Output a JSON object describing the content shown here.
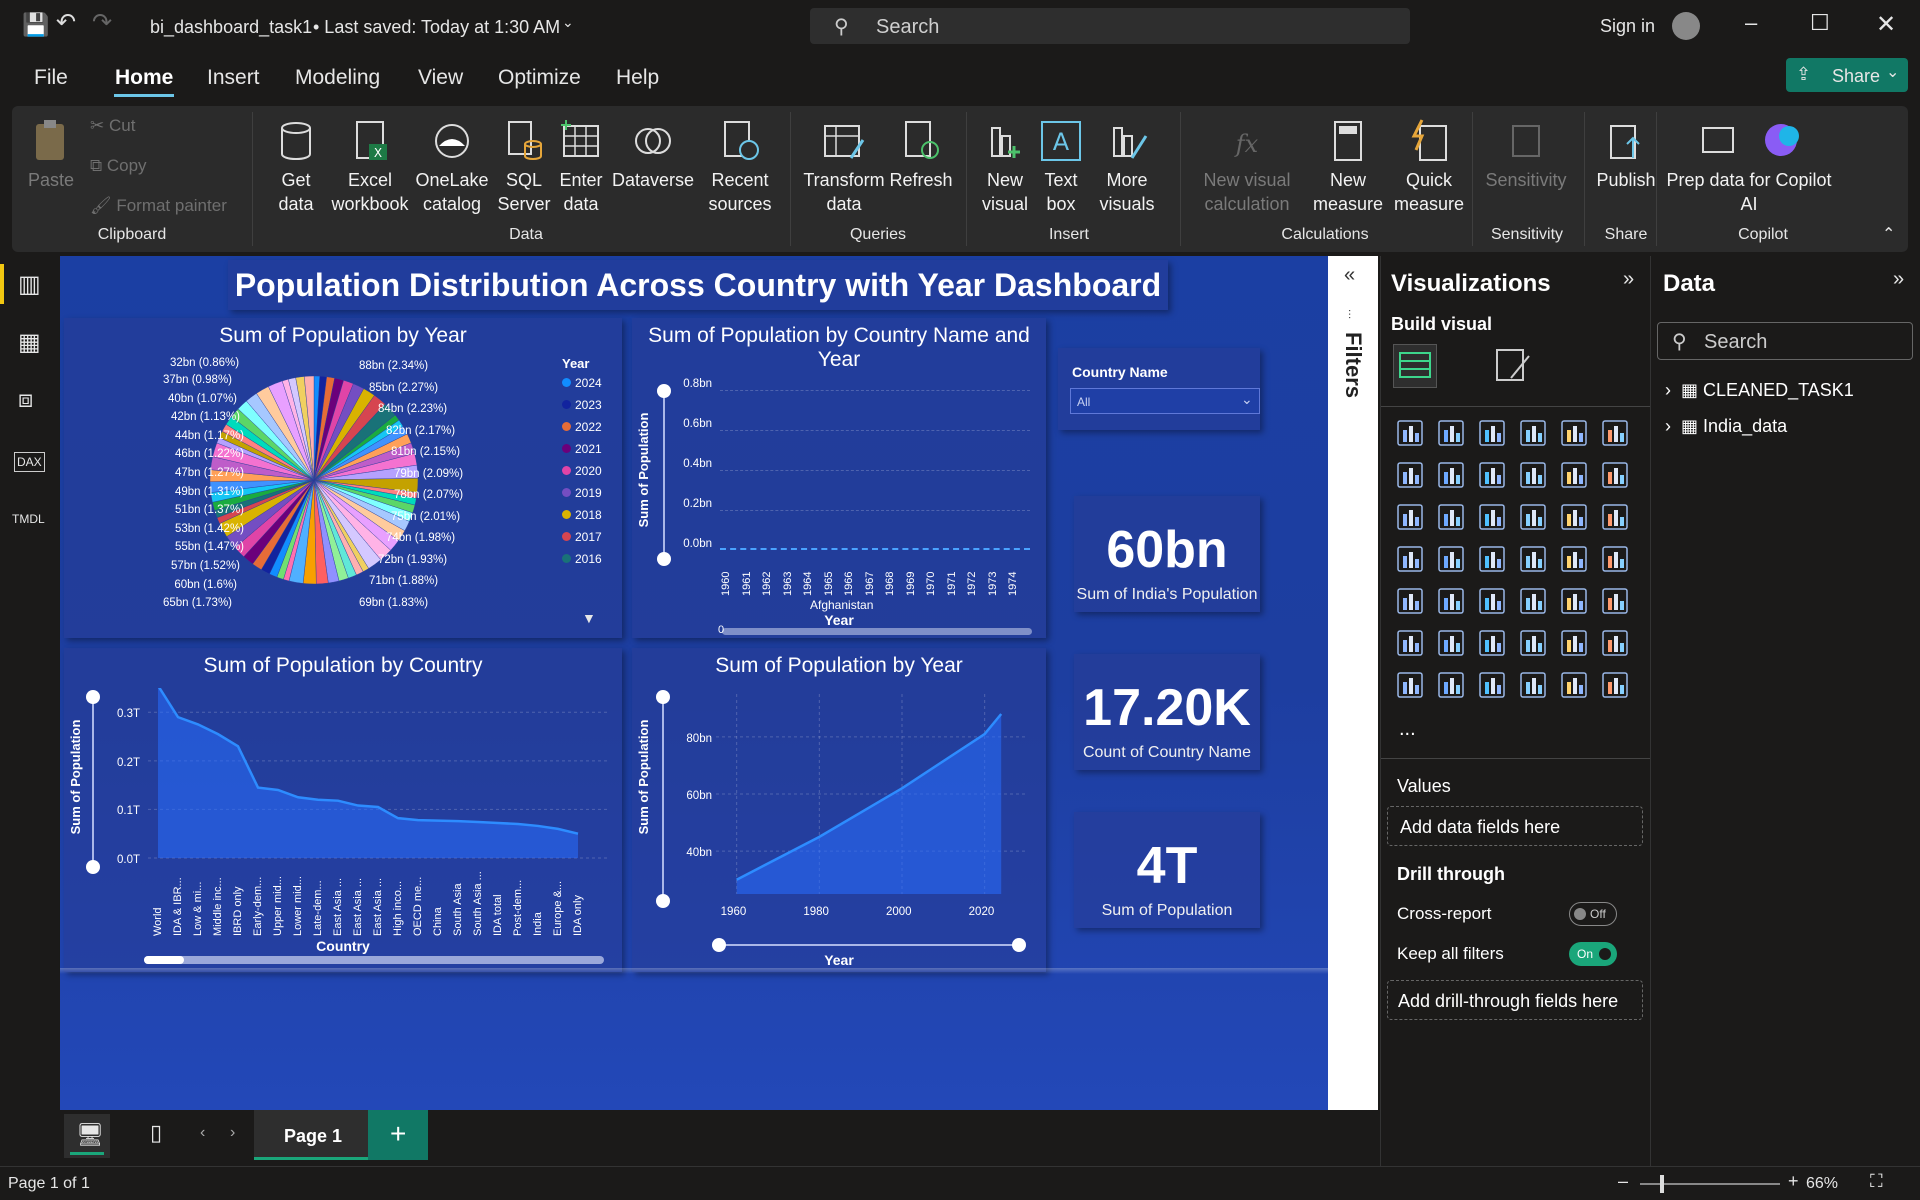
{
  "titlebar": {
    "filename": "bi_dashboard_task1",
    "saved": "• Last saved: Today at 1:30 AM",
    "search_placeholder": "Search",
    "signin": "Sign in",
    "share": "Share"
  },
  "menu": [
    "File",
    "Home",
    "Insert",
    "Modeling",
    "View",
    "Optimize",
    "Help"
  ],
  "ribbon": {
    "paste": "Paste",
    "cut": "Cut",
    "copy": "Copy",
    "format_painter": "Format painter",
    "get_data": "Get data",
    "excel": "Excel workbook",
    "onelake": "OneLake catalog",
    "sql": "SQL Server",
    "enter": "Enter data",
    "dataverse": "Dataverse",
    "recent": "Recent sources",
    "transform": "Transform data",
    "refresh": "Refresh",
    "new_visual": "New visual",
    "text_box": "Text box",
    "more_visuals": "More visuals",
    "new_calc": "New visual calculation",
    "new_measure": "New measure",
    "quick_measure": "Quick measure",
    "sensitivity": "Sensitivity",
    "publish": "Publish",
    "prep": "Prep data for Copilot AI",
    "groups": {
      "clipboard": "Clipboard",
      "data": "Data",
      "queries": "Queries",
      "insert": "Insert",
      "calculations": "Calculations",
      "sensitivity": "Sensitivity",
      "share": "Share",
      "copilot": "Copilot"
    }
  },
  "dashboard": {
    "title": "Population Distribution Across Country with Year Dashboard",
    "pie_title": "Sum of Population by Year",
    "pie_legend_title": "Year",
    "pie_legend": [
      {
        "label": "2024",
        "color": "#118dff"
      },
      {
        "label": "2023",
        "color": "#12239e"
      },
      {
        "label": "2022",
        "color": "#e66c37"
      },
      {
        "label": "2021",
        "color": "#6b007b"
      },
      {
        "label": "2020",
        "color": "#e044a7"
      },
      {
        "label": "2019",
        "color": "#744ec2"
      },
      {
        "label": "2018",
        "color": "#d9b300"
      },
      {
        "label": "2017",
        "color": "#d64550"
      },
      {
        "label": "2016",
        "color": "#197278"
      }
    ],
    "pie_labels_left": [
      "32bn (0.86%)",
      "37bn (0.98%)",
      "40bn (1.07%)",
      "42bn (1.13%)",
      "44bn (1.17%)",
      "46bn (1.22%)",
      "47bn (1.27%)",
      "49bn (1.31%)",
      "51bn (1.37%)",
      "53bn (1.42%)",
      "55bn (1.47%)",
      "57bn (1.52%)",
      "60bn (1.6%)",
      "65bn (1.73%)"
    ],
    "pie_labels_right": [
      "88bn (2.34%)",
      "85bn (2.27%)",
      "84bn (2.23%)",
      "82bn (2.17%)",
      "81bn (2.15%)",
      "79bn (2.09%)",
      "78bn (2.07%)",
      "75bn (2.01%)",
      "74bn (1.98%)",
      "72bn (1.93%)",
      "71bn (1.88%)",
      "69bn (1.83%)"
    ],
    "bar_title": "Sum of Population by Country Name and Year",
    "bar_ylabel": "Sum of Population",
    "bar_xlabel": "Year",
    "bar_category": "Afghanistan",
    "bar_yticks": [
      "0.8bn",
      "0.6bn",
      "0.4bn",
      "0.2bn",
      "0.0bn"
    ],
    "bar_xticks": [
      "1960",
      "1961",
      "1962",
      "1963",
      "1964",
      "1965",
      "1966",
      "1967",
      "1968",
      "1969",
      "1970",
      "1971",
      "1972",
      "1973",
      "1974"
    ],
    "bar_scroll_label": "0",
    "slicer_title": "Country Name",
    "slicer_value": "All",
    "country_title": "Sum of Population by Country",
    "country_ylabel": "Sum of Population",
    "country_xlabel": "Country",
    "country_yticks": [
      "0.3T",
      "0.2T",
      "0.1T",
      "0.0T"
    ],
    "country_xticks": [
      "World",
      "IDA & IBR...",
      "Low & mi...",
      "Middle inc...",
      "IBRD only",
      "Early-dem...",
      "Upper mid...",
      "Lower mid...",
      "Late-dem...",
      "East Asia ...",
      "East Asia ...",
      "East Asia ...",
      "High inco...",
      "OECD me...",
      "China",
      "South Asia",
      "South Asia ...",
      "IDA total",
      "Post-dem...",
      "India",
      "Europe &...",
      "IDA only"
    ],
    "country_values": [
      0.355,
      0.29,
      0.275,
      0.255,
      0.23,
      0.145,
      0.14,
      0.125,
      0.12,
      0.118,
      0.108,
      0.105,
      0.082,
      0.078,
      0.077,
      0.076,
      0.074,
      0.072,
      0.07,
      0.066,
      0.06,
      0.05
    ],
    "year_title": "Sum of Population by Year",
    "year_ylabel": "Sum of Population",
    "year_xlabel": "Year",
    "year_yticks": [
      "80bn",
      "60bn",
      "40bn"
    ],
    "year_xticks": [
      "1960",
      "1980",
      "2000",
      "2020"
    ],
    "card1_value": "60bn",
    "card1_label": "Sum of India's Population",
    "card2_value": "17.20K",
    "card2_label": "Count of Country Name",
    "card3_value": "4T",
    "card3_label": "Sum of Population"
  },
  "chart_data": [
    {
      "type": "pie",
      "title": "Sum of Population by Year",
      "legend_title": "Year",
      "labels_shown": [
        "88bn (2.34%)",
        "85bn (2.27%)",
        "84bn (2.23%)",
        "82bn (2.17%)",
        "81bn (2.15%)",
        "79bn (2.09%)",
        "78bn (2.07%)",
        "75bn (2.01%)",
        "74bn (1.98%)",
        "72bn (1.93%)",
        "71bn (1.88%)",
        "69bn (1.83%)",
        "65bn (1.73%)",
        "60bn (1.6%)",
        "57bn (1.52%)",
        "55bn (1.47%)",
        "53bn (1.42%)",
        "51bn (1.37%)",
        "49bn (1.31%)",
        "47bn (1.27%)",
        "46bn (1.22%)",
        "44bn (1.17%)",
        "42bn (1.13%)",
        "40bn (1.07%)",
        "37bn (0.98%)",
        "32bn (0.86%)"
      ]
    },
    {
      "type": "area",
      "title": "Sum of Population by Country",
      "xlabel": "Country",
      "ylabel": "Sum of Population",
      "ylim": [
        0,
        0.35
      ]
    },
    {
      "type": "area",
      "title": "Sum of Population by Year",
      "xlabel": "Year",
      "ylabel": "Sum of Population",
      "x": [
        1960,
        1980,
        2000,
        2020,
        2024
      ],
      "values": [
        30,
        45,
        62,
        81,
        88
      ]
    }
  ],
  "filters_label": "Filters",
  "viz_panel": {
    "title": "Visualizations",
    "build": "Build visual",
    "values": "Values",
    "add_fields": "Add data fields here",
    "drill": "Drill through",
    "cross": "Cross-report",
    "cross_state": "Off",
    "keep": "Keep all filters",
    "keep_state": "On",
    "add_drill": "Add drill-through fields here",
    "more": "..."
  },
  "data_panel": {
    "title": "Data",
    "search_placeholder": "Search",
    "tables": [
      "CLEANED_TASK1",
      "India_data"
    ]
  },
  "pages": {
    "tab": "Page 1",
    "add": "+"
  },
  "status": {
    "page": "Page 1 of 1",
    "zoom": "66%"
  }
}
